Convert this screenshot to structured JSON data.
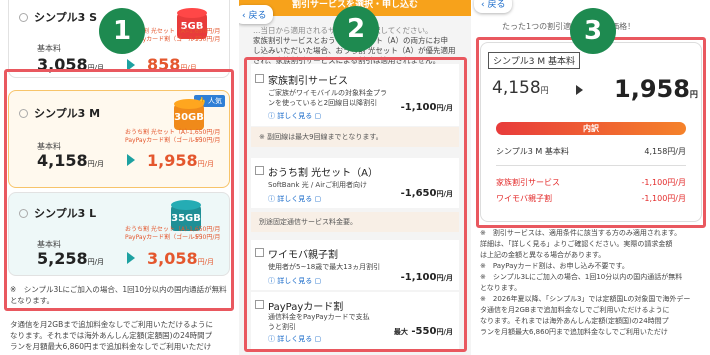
{
  "badges": [
    "1",
    "2",
    "3"
  ],
  "panel1": {
    "plans": [
      {
        "name": "シンプル3 S",
        "base_label": "基本料",
        "base_price": "3,058",
        "price_unit": "円/月",
        "gb": "5GB",
        "disc_price": "858",
        "disc_unit": "円/月",
        "disc_line1": "おうち割 光セット（A）",
        "disc_line2": "PayPayカード割（ゴールド）",
        "disc_amt1": "-1,650円/月",
        "disc_amt2": "-550円/月"
      },
      {
        "name": "シンプル3 M",
        "base_label": "基本料",
        "base_price": "4,158",
        "price_unit": "円/月",
        "gb": "30GB",
        "tag": "人気",
        "disc_price": "1,958",
        "disc_unit": "円/月",
        "disc_line1": "おうち割 光セット（A）",
        "disc_line2": "PayPayカード割（ゴールド）",
        "disc_amt1": "-1,650円/月",
        "disc_amt2": "-550円/月"
      },
      {
        "name": "シンプル3 L",
        "base_label": "基本料",
        "base_price": "5,258",
        "price_unit": "円/月",
        "gb": "35GB",
        "disc_price": "3,058",
        "disc_unit": "円/月",
        "disc_line1": "おうち割 光セット（A）",
        "disc_line2": "PayPayカード割（ゴールド）",
        "disc_amt1": "-1,650円/月",
        "disc_amt2": "-550円/月"
      }
    ],
    "note_a": "※　シンプル3Lにご加入の場合、1回10分以内の国内通話が無料",
    "note_b": "となります。",
    "note_c": "タ通信を月2GBまで追加料金なしでご利用いただけるように",
    "note_d": "なります。それまでは海外あんしん定額(定額国)の24時間プ",
    "note_e": "ランを月額最大6,860円まで追加料金なしでご利用いただけ"
  },
  "panel2": {
    "back_label": "戻る",
    "header": "割引サービスを選択・申し込む",
    "intro1": "…当日から適用されるサービスを選択してください。",
    "intro2": "家族割引サービスとおうち割 光セット（A）の両方にお申",
    "intro3": "し込みいただいた場合、おうち割 光セット（A）が優先適用",
    "intro4": "され、家族割引サービスによる割引は適用されません。",
    "services": [
      {
        "title": "家族割引サービス",
        "desc1": "ご家族がワイモバイルの対象料金プラ",
        "desc2": "ンを使っていると2回線目以降割引",
        "link": "詳しく見る",
        "price": "-1,100",
        "unit": "円/月"
      },
      {
        "title": "おうち割 光セット（A）",
        "desc1": "SoftBank 光 / Airご利用者向け",
        "desc2": "",
        "link": "詳しく見る",
        "price": "-1,650",
        "unit": "円/月"
      },
      {
        "title": "ワイモバ親子割",
        "desc1": "使用者が5~18歳で最大13ヵ月割引",
        "desc2": "",
        "link": "詳しく見る",
        "price": "-1,100",
        "unit": "円/月"
      },
      {
        "title": "PayPayカード割",
        "desc1": "通信料金をPayPayカードで支払",
        "desc2": "うと割引",
        "link": "詳しく見る",
        "price": "-550",
        "prefix": "最大",
        "unit": "円/月"
      }
    ],
    "info1": "※ 副回線は最大9回線までとなります。",
    "info2": "別途固定通信サービス料金要。"
  },
  "panel3": {
    "back_label": "戻る",
    "header": "たった1つの割引適用で",
    "header_b": "価格！",
    "plan_tag": "シンプル3 M 基本料",
    "price_before": "4,158",
    "price_after": "1,958",
    "yen": "円",
    "per_month": "円/月",
    "breakdown_label": "内訳",
    "rows": [
      {
        "label": "シンプル3 M 基本料",
        "value": "4,158円/月"
      },
      {
        "label": "家族割引サービス",
        "value": "-1,100円/月"
      },
      {
        "label": "ワイモバ親子割",
        "value": "-1,100円/月"
      }
    ],
    "notes": [
      "※　割引サービスは、適用条件に該当する方のみ適用されます。",
      "詳細は、「詳しく見る」よりご確認ください。実際の請求金額",
      "は上記の金額と異なる場合があります。",
      "※　PayPayカード割は、お申し込み不要です。",
      "※　シンプル3Lにご加入の場合、1回10分以内の国内通話が無料",
      "となります。",
      "※　2026年夏以降、「シンプル3」では定額国Lの対象国で海外デー",
      "タ通信を月2GBまで追加料金なしでご利用いただけるように",
      "なります。それまでは海外あんしん定額(定額国)の24時間プ",
      "ランを月額最大6,860円まで追加料金なしでご利用いただけ"
    ]
  },
  "colors": {
    "highlight": "#e9585f",
    "badge": "#1e8a50",
    "discount": "#e4572e",
    "teal": "#1da1a1"
  }
}
